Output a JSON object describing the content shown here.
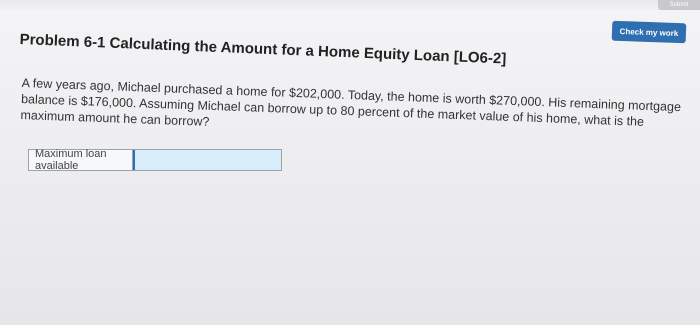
{
  "header": {
    "submit_label": "Submit",
    "check_work_label": "Check my work"
  },
  "problem": {
    "title": "Problem 6-1 Calculating the Amount for a Home Equity Loan [LO6-2]",
    "question": "A few years ago, Michael purchased a home for $202,000. Today, the home is worth $270,000. His remaining mortgage balance is $176,000. Assuming Michael can borrow up to 80 percent of the market value of his home, what is the maximum amount he can borrow?"
  },
  "answer": {
    "label": "Maximum loan available",
    "value": ""
  }
}
